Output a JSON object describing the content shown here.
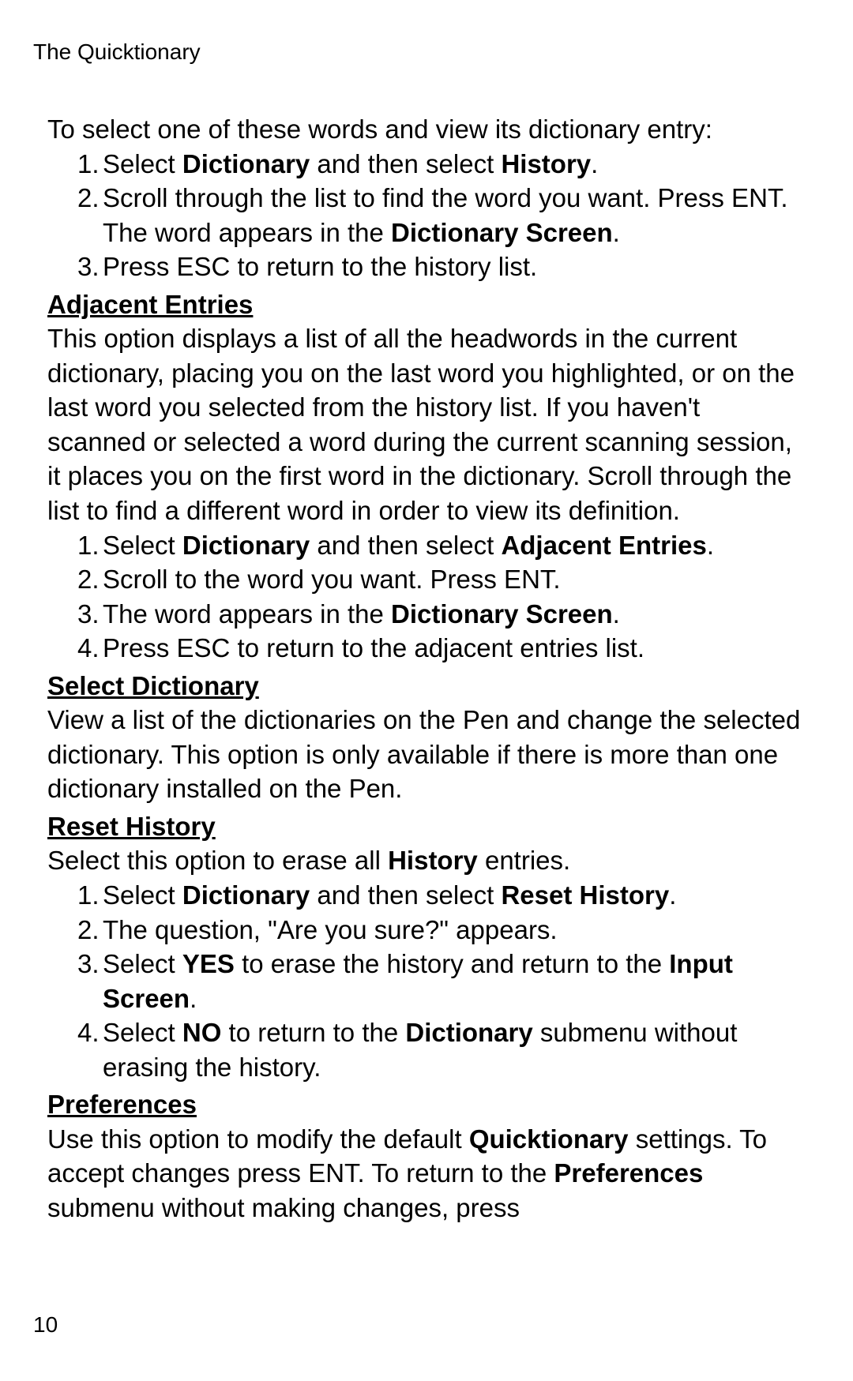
{
  "header": "The Quicktionary",
  "pageNumber": "10",
  "intro": "To select one of these words and view its dictionary entry:",
  "list1": {
    "i1": {
      "num": "1.",
      "pre": "Select ",
      "b1": "Dictionary",
      "mid": " and then select ",
      "b2": "History",
      "post": "."
    },
    "i2": {
      "num": "2.",
      "pre": "Scroll through the list to find the word you want. Press ENT. The word appears in the ",
      "b1": "Dictionary Screen",
      "post": "."
    },
    "i3": {
      "num": "3.",
      "text": "Press ESC to return to the history list."
    }
  },
  "sec1": {
    "heading": "Adjacent Entries",
    "para": "This option displays a list of all the headwords in the current dictionary, placing you on the last word you highlighted, or on the last word you selected from the history list. If you haven't scanned or selected a word during the current scanning session, it places you on the first word in the dictionary. Scroll through the list to find a different word in order to view its definition."
  },
  "list2": {
    "i1": {
      "num": "1.",
      "pre": "Select ",
      "b1": "Dictionary",
      "mid": " and then select ",
      "b2": "Adjacent Entries",
      "post": "."
    },
    "i2": {
      "num": "2.",
      "text": "Scroll to the word you want. Press ENT."
    },
    "i3": {
      "num": "3.",
      "pre": "The word appears in the ",
      "b1": "Dictionary Screen",
      "post": "."
    },
    "i4": {
      "num": "4.",
      "text": "Press ESC to return to the adjacent entries list."
    }
  },
  "sec2": {
    "heading": "Select Dictionary",
    "para": "View a list of the dictionaries on the Pen and change the selected dictionary. This option is only available if there is more than one dictionary installed on the Pen."
  },
  "sec3": {
    "heading": "Reset History",
    "para_pre": "Select this option to erase all ",
    "para_b": "History",
    "para_post": " entries."
  },
  "list3": {
    "i1": {
      "num": "1.",
      "pre": "Select ",
      "b1": "Dictionary",
      "mid": " and then select ",
      "b2": "Reset History",
      "post": "."
    },
    "i2": {
      "num": "2.",
      "text": "The question, \"Are you sure?\" appears."
    },
    "i3": {
      "num": "3.",
      "pre": "Select ",
      "b1": "YES",
      "mid": " to erase the history and return to the ",
      "b2": "Input Screen",
      "post": "."
    },
    "i4": {
      "num": "4.",
      "pre": "Select ",
      "b1": "NO",
      "mid": " to return to the ",
      "b2": "Dictionary",
      "post": " submenu without erasing the history."
    }
  },
  "sec4": {
    "heading": "Preferences",
    "p1_pre": "Use this option to modify the default ",
    "p1_b": "Quicktionary",
    "p1_post": " settings. To accept changes press ENT. To return to the ",
    "p2_b": "Preferences",
    "p2_post": " submenu without making changes, press"
  }
}
